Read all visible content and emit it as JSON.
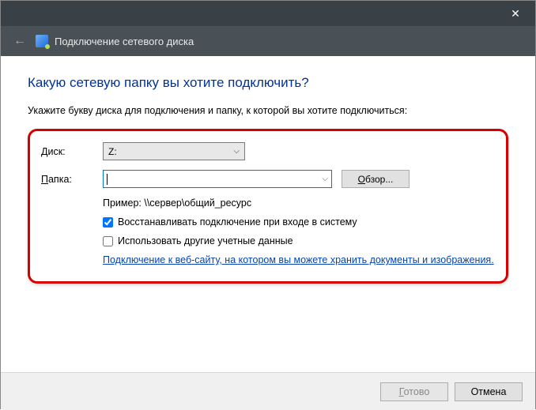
{
  "titlebar": {
    "close_glyph": "✕"
  },
  "subheader": {
    "title": "Подключение сетевого диска"
  },
  "page": {
    "heading": "Какую сетевую папку вы хотите подключить?",
    "instruction": "Укажите букву диска для подключения и папку, к которой вы хотите подключиться:"
  },
  "form": {
    "drive_label": "Диск:",
    "drive_value": "Z:",
    "folder_label": "Папка:",
    "folder_value": "",
    "browse_label": "Обзор...",
    "example": "Пример: \\\\сервер\\общий_ресурс",
    "reconnect_label": "Восстанавливать подключение при входе в систему",
    "reconnect_checked": true,
    "othercreds_label": "Использовать другие учетные данные",
    "othercreds_checked": false,
    "link_text": "Подключение к веб-сайту, на котором вы можете хранить документы и изображения."
  },
  "footer": {
    "finish_label": "Готово",
    "cancel_label": "Отмена"
  }
}
